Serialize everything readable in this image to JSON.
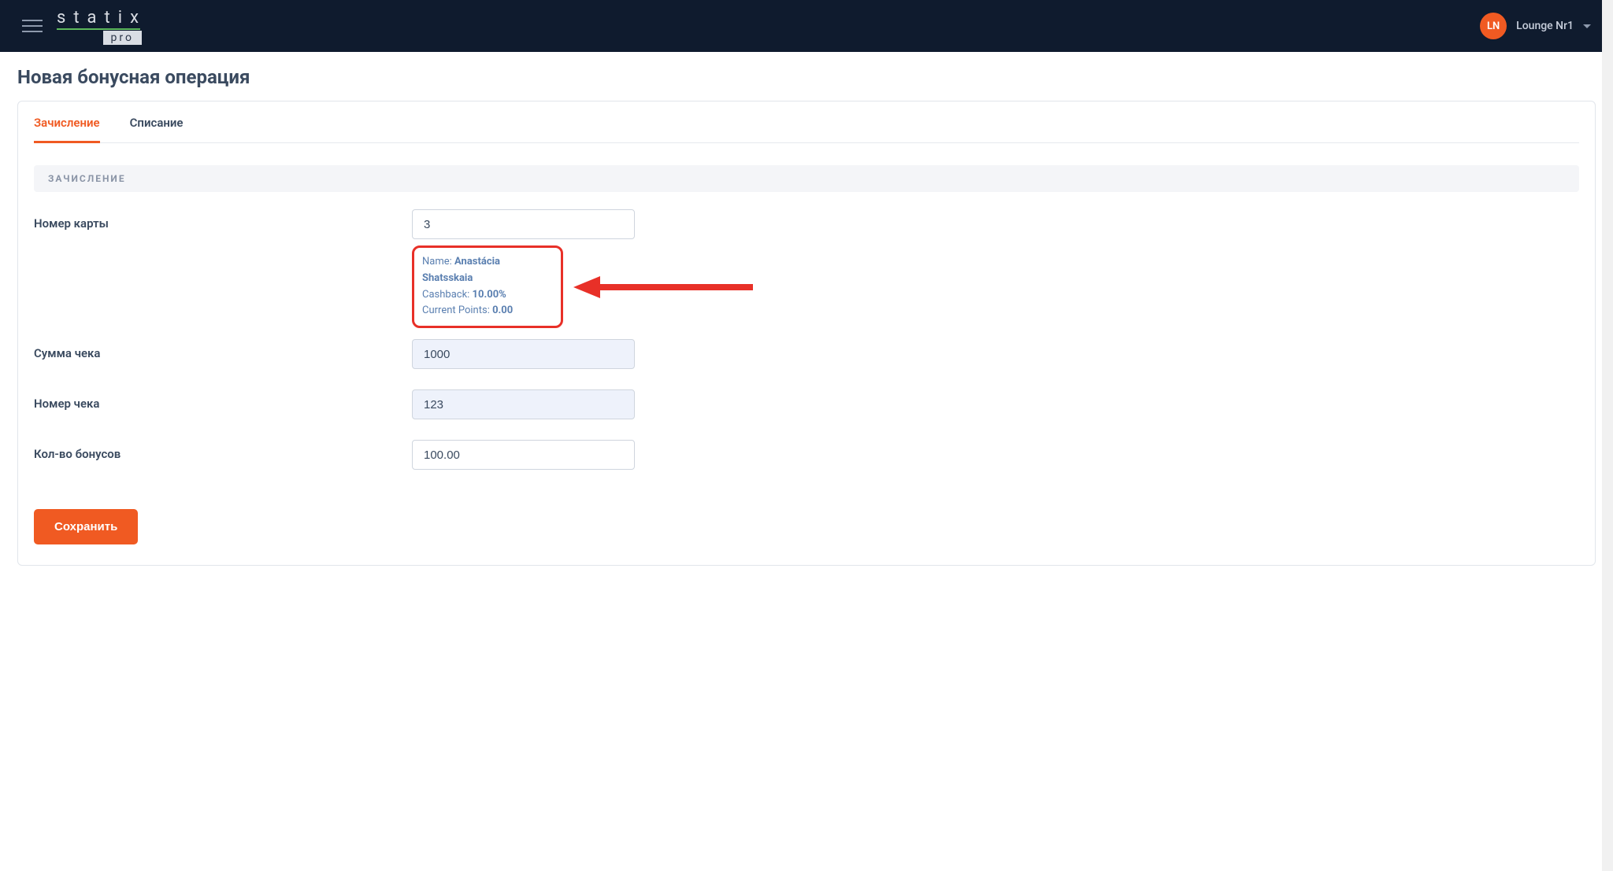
{
  "header": {
    "logo_text": "statix",
    "logo_badge": "pro",
    "avatar_initials": "LN",
    "user_name": "Lounge Nr1"
  },
  "page": {
    "title": "Новая бонусная операция"
  },
  "tabs": {
    "credit": "Зачисление",
    "debit": "Списание"
  },
  "section": {
    "header": "ЗАЧИСЛЕНИЕ"
  },
  "labels": {
    "card_number": "Номер карты",
    "check_amount": "Сумма чека",
    "check_number": "Номер чека",
    "bonus_qty": "Кол-во бонусов"
  },
  "values": {
    "card_number": "3",
    "check_amount": "1000",
    "check_number": "123",
    "bonus_qty": "100.00"
  },
  "info": {
    "name_label": "Name: ",
    "name_value": "Anastácia Shatsskaia",
    "cashback_label": "Cashback: ",
    "cashback_value": "10.00%",
    "points_label": "Current Points: ",
    "points_value": "0.00"
  },
  "buttons": {
    "save": "Сохранить"
  }
}
